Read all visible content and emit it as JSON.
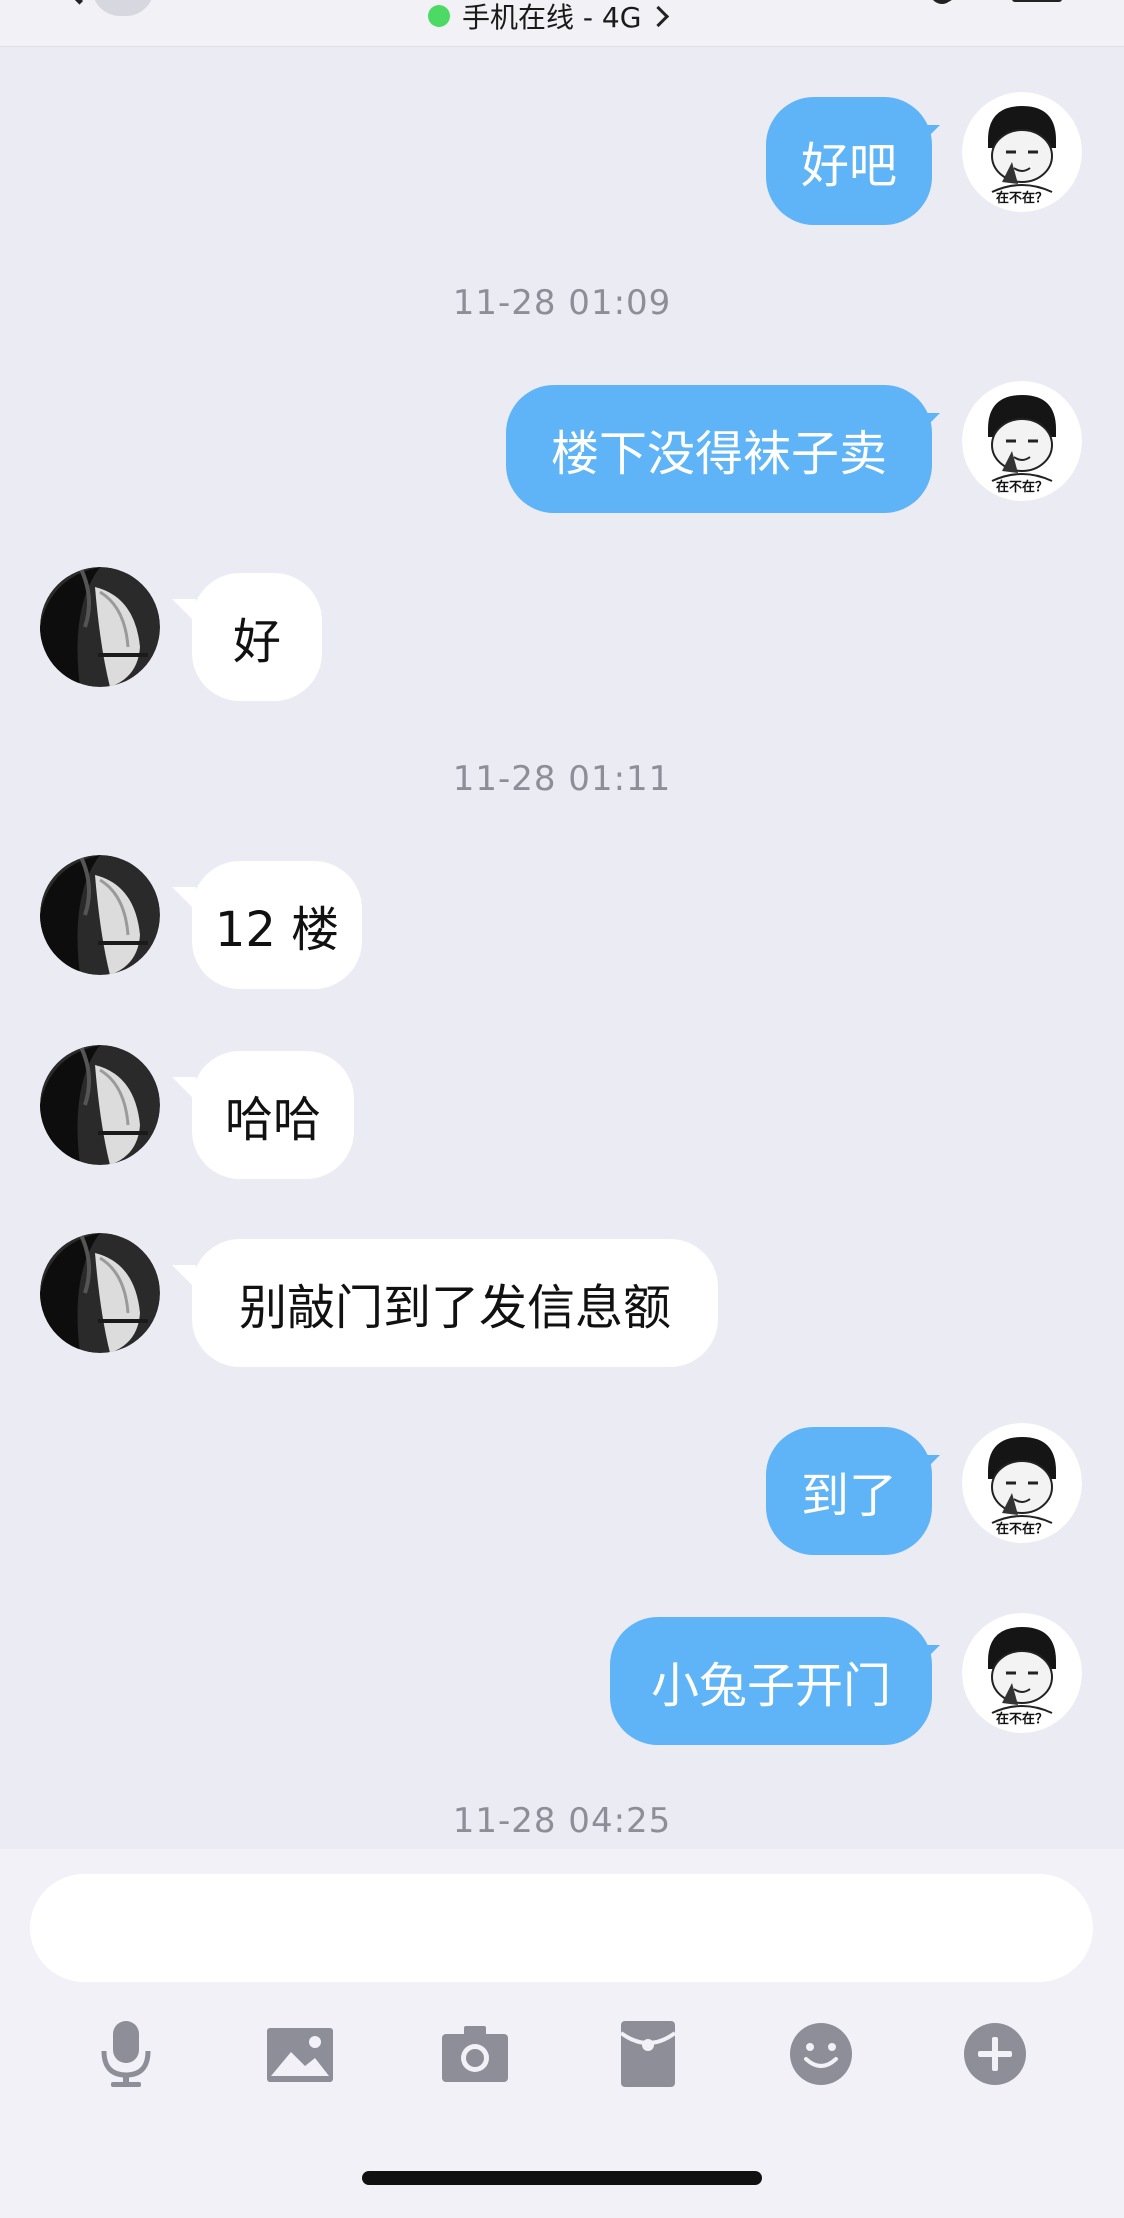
{
  "header": {
    "status_text": "手机在线 - 4G"
  },
  "messages": [
    {
      "side": "mine",
      "text": "好吧"
    },
    {
      "timestamp": "11-28 01:09"
    },
    {
      "side": "mine",
      "text": "楼下没得袜子卖"
    },
    {
      "side": "theirs",
      "text": "好"
    },
    {
      "timestamp": "11-28 01:11"
    },
    {
      "side": "theirs",
      "text": "12 楼"
    },
    {
      "side": "theirs",
      "text": "哈哈"
    },
    {
      "side": "theirs",
      "text": "别敲门到了发信息额"
    },
    {
      "side": "mine",
      "text": "到了"
    },
    {
      "side": "mine",
      "text": "小兔子开门"
    },
    {
      "timestamp": "11-28 04:25"
    }
  ],
  "my_avatar_caption": "在不在？",
  "input": {
    "placeholder": ""
  },
  "toolbar": {
    "icons": [
      "microphone-icon",
      "image-icon",
      "camera-icon",
      "red-packet-icon",
      "emoji-icon",
      "plus-icon"
    ]
  },
  "colors": {
    "my_bubble": "#5eb4f6",
    "their_bubble": "#ffffff",
    "background": "#ebebf3",
    "online_dot": "#4cd964"
  }
}
